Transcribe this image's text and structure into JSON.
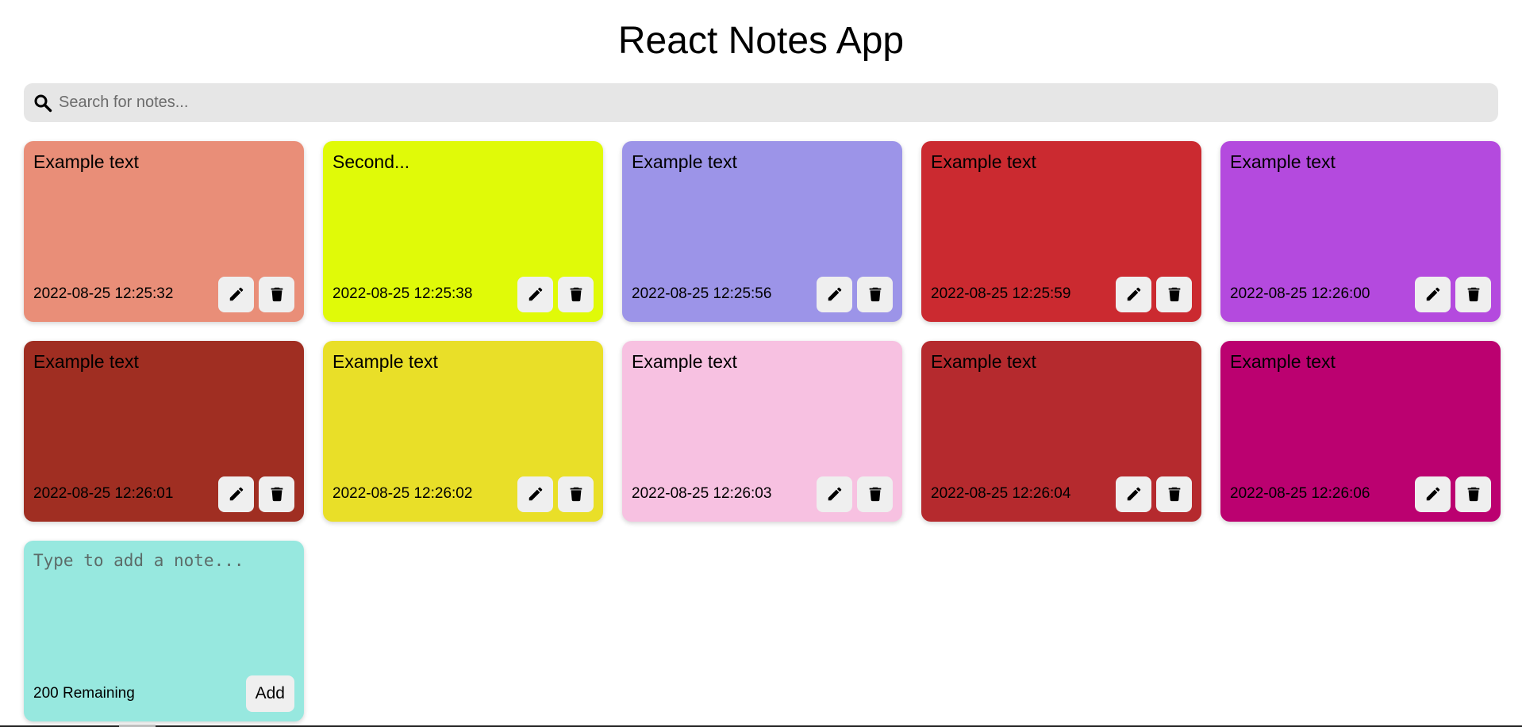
{
  "header": {
    "title": "React Notes App"
  },
  "search": {
    "placeholder": "Search for notes...",
    "value": "",
    "icon": "search-icon"
  },
  "notes": [
    {
      "text": "Example text",
      "date": "2022-08-25 12:25:32",
      "color": "#e98e78"
    },
    {
      "text": "Second...",
      "date": "2022-08-25 12:25:38",
      "color": "#e0fa08"
    },
    {
      "text": "Example text",
      "date": "2022-08-25 12:25:56",
      "color": "#9c94e8"
    },
    {
      "text": "Example text",
      "date": "2022-08-25 12:25:59",
      "color": "#cb2a30"
    },
    {
      "text": "Example text",
      "date": "2022-08-25 12:26:00",
      "color": "#b44ade"
    },
    {
      "text": "Example text",
      "date": "2022-08-25 12:26:01",
      "color": "#a02e22"
    },
    {
      "text": "Example text",
      "date": "2022-08-25 12:26:02",
      "color": "#e9df28"
    },
    {
      "text": "Example text",
      "date": "2022-08-25 12:26:03",
      "color": "#f7c1e1"
    },
    {
      "text": "Example text",
      "date": "2022-08-25 12:26:04",
      "color": "#b52a2e"
    },
    {
      "text": "Example text",
      "date": "2022-08-25 12:26:06",
      "color": "#bb0170"
    }
  ],
  "note_actions": {
    "edit_icon": "pencil-icon",
    "delete_icon": "trash-icon"
  },
  "new_note": {
    "placeholder": "Type to add a note...",
    "value": "",
    "remaining_label": "200 Remaining",
    "add_label": "Add",
    "color": "#97e8df"
  }
}
